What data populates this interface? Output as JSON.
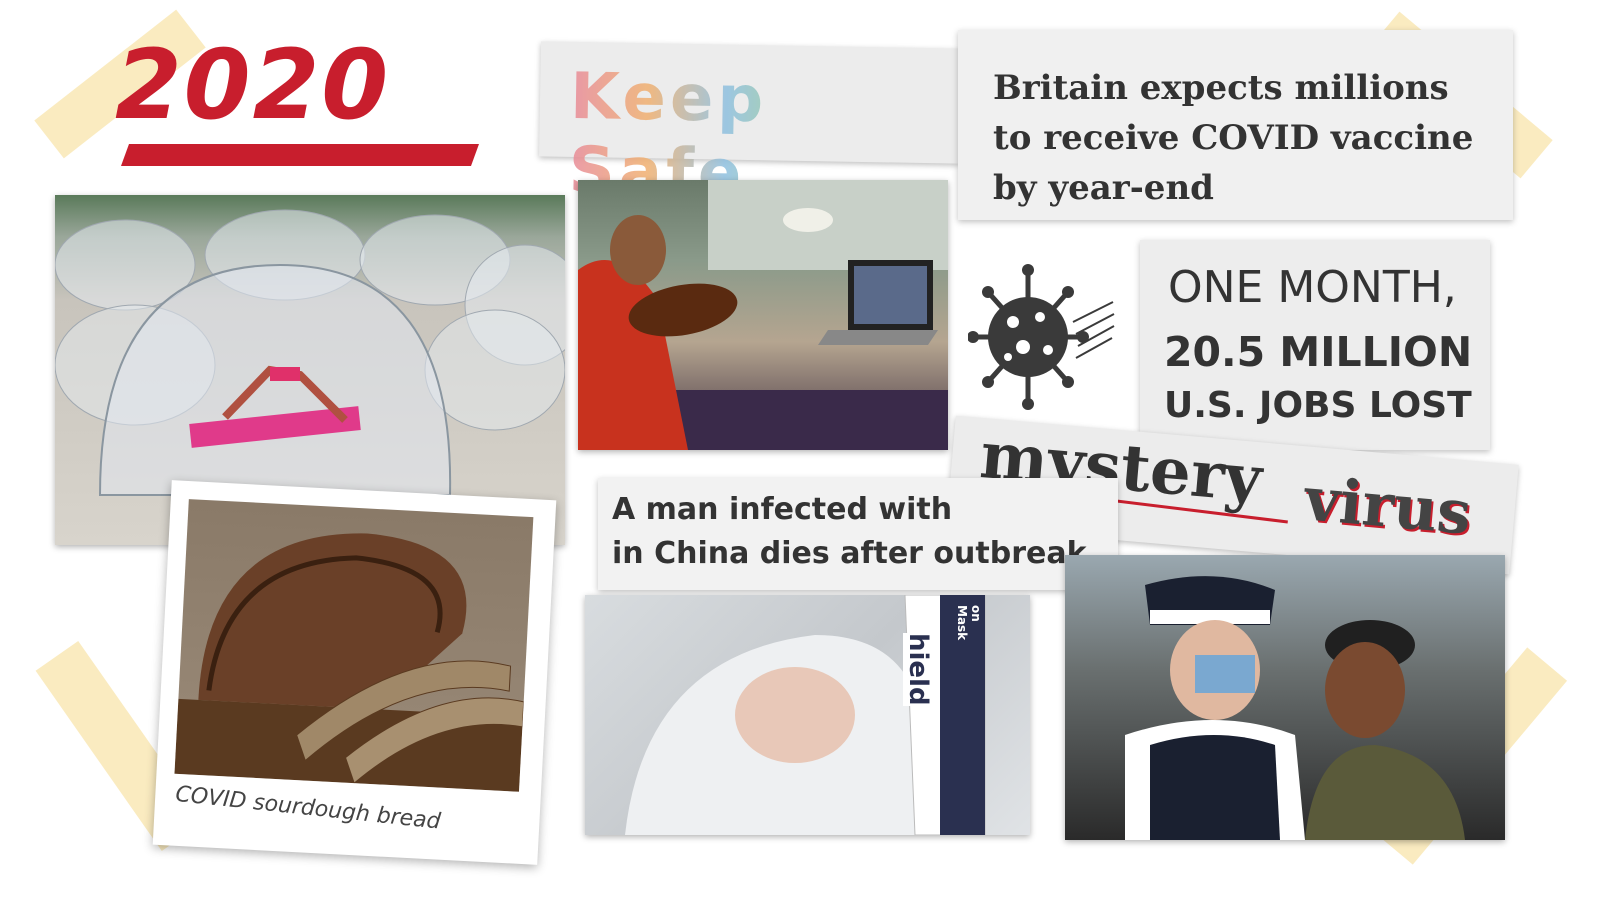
{
  "title": "2020",
  "keep_safe": "Keep Safe",
  "headline_vaccine": [
    "Britain expects millions",
    "to receive COVID vaccine",
    "by year-end"
  ],
  "jobs": {
    "line1": "ONE MONTH,",
    "line2": "20.5 MILLION",
    "line3": "U.S. JOBS LOST"
  },
  "mystery": {
    "word1": "mystery",
    "word2": "virus"
  },
  "headline_china": [
    "A man infected with",
    "in China dies after outbreak"
  ],
  "bread_caption": "COVID sourdough bread",
  "mask_text": {
    "brand": "hield",
    "sub": "on Mask"
  },
  "icons": {
    "virus": "virus-icon"
  },
  "colors": {
    "red": "#c81e2d",
    "dark": "#333333",
    "tape": "#f7de96"
  }
}
